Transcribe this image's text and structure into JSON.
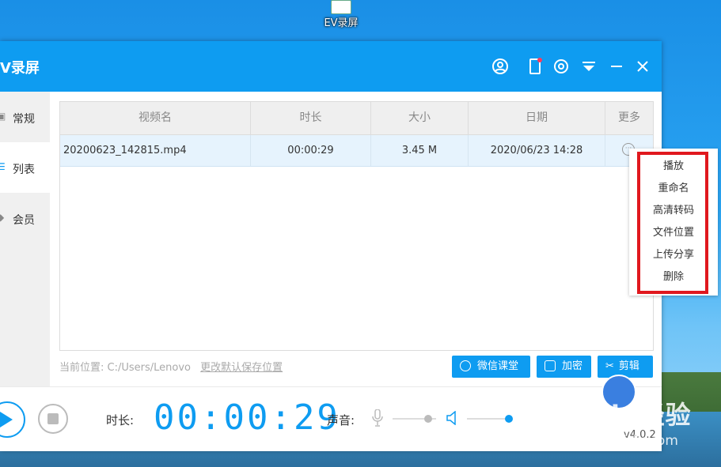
{
  "desktop": {
    "icon_label": "EV录屏"
  },
  "window": {
    "title": "V录屏",
    "icons": [
      "user-circle-icon",
      "phone-notify-icon",
      "gear-icon",
      "filter-icon",
      "minimize-icon",
      "close-icon"
    ]
  },
  "sidebar": {
    "items": [
      {
        "label": "常规",
        "icon": "grid-icon"
      },
      {
        "label": "列表",
        "icon": "list-icon",
        "active": true
      },
      {
        "label": "会员",
        "icon": "diamond-icon"
      }
    ]
  },
  "table": {
    "columns": [
      "视频名",
      "时长",
      "大小",
      "日期",
      "更多"
    ],
    "rows": [
      {
        "name": "20200623_142815.mp4",
        "duration": "00:00:29",
        "size": "3.45 M",
        "date": "2020/06/23 14:28"
      }
    ]
  },
  "path": {
    "label": "当前位置:",
    "value": "C:/Users/Lenovo",
    "link": "更改默认保存位置"
  },
  "buttons": {
    "wechat": "微信课堂",
    "encrypt": "加密",
    "edit": "剪辑"
  },
  "controls": {
    "duration_label": "时长:",
    "timer": "00:00:29",
    "sound_label": "声音:",
    "version": "v4.0.2",
    "mic_level": 0.82,
    "speaker_level": 0.98
  },
  "context_menu": {
    "items": [
      "播放",
      "重命名",
      "高清转码",
      "文件位置",
      "上传分享",
      "删除"
    ]
  },
  "watermark": {
    "line1": "Baidu经验",
    "line2": "jingyan.baidu.com"
  },
  "colors": {
    "accent": "#0e9cf1",
    "highlight": "#e0181e"
  }
}
